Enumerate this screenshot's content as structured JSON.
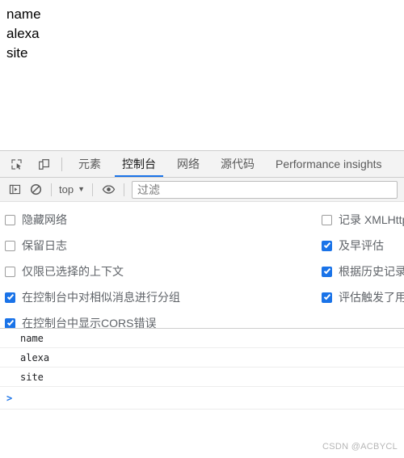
{
  "page": {
    "lines": [
      "name",
      "alexa",
      "site"
    ]
  },
  "tabbar": {
    "inspect_icon": "inspect-element-icon",
    "device_icon": "device-toolbar-icon",
    "tabs": [
      {
        "label": "元素",
        "active": false
      },
      {
        "label": "控制台",
        "active": true
      },
      {
        "label": "网络",
        "active": false
      },
      {
        "label": "源代码",
        "active": false
      },
      {
        "label": "Performance insights",
        "active": false
      }
    ]
  },
  "console_toolbar": {
    "sidebar_icon": "console-sidebar-icon",
    "clear_icon": "clear-console-icon",
    "context_label": "top",
    "context_caret": "▼",
    "eye_icon": "live-expression-eye-icon",
    "filter_placeholder": "过滤",
    "filter_value": ""
  },
  "settings": {
    "left": [
      {
        "label": "隐藏网络",
        "checked": false
      },
      {
        "label": "保留日志",
        "checked": false
      },
      {
        "label": "仅限已选择的上下文",
        "checked": false
      },
      {
        "label": "在控制台中对相似消息进行分组",
        "checked": true
      },
      {
        "label": "在控制台中显示CORS错误",
        "checked": true
      }
    ],
    "right": [
      {
        "label": "记录 XMLHttpRequest",
        "checked": false
      },
      {
        "label": "及早评估",
        "checked": true
      },
      {
        "label": "根据历史记录自动补全",
        "checked": true
      },
      {
        "label": "评估触发了用户手势",
        "checked": true
      }
    ]
  },
  "console_output": {
    "rows": [
      "name",
      "alexa",
      "site"
    ],
    "prompt": ">"
  },
  "watermark": {
    "text": "CSDN @ACBYCL"
  },
  "colors": {
    "accent": "#1a73e8",
    "toolbar_bg": "#f3f3f3",
    "text": "#202124",
    "muted": "#5f6368",
    "border": "#cdcdcd"
  }
}
